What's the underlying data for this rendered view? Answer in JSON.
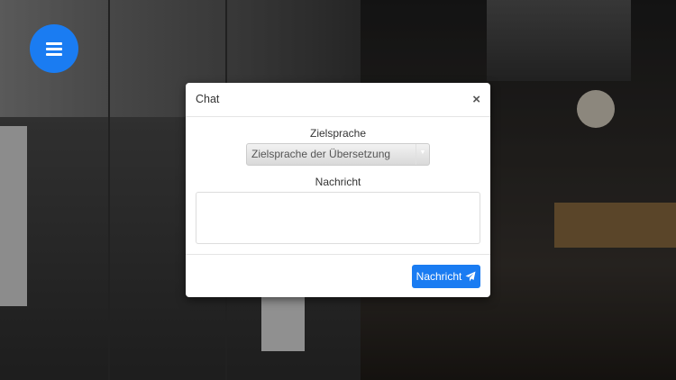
{
  "menu": {
    "icon": "hamburger-icon"
  },
  "modal": {
    "title": "Chat",
    "close_label": "×",
    "language_label": "Zielsprache",
    "language_select": {
      "selected": "Zielsprache der Übersetzung"
    },
    "message_label": "Nachricht",
    "message_value": "",
    "send_button": {
      "label": "Nachricht",
      "icon": "paper-plane-icon"
    }
  },
  "colors": {
    "accent": "#1a7cf2"
  }
}
